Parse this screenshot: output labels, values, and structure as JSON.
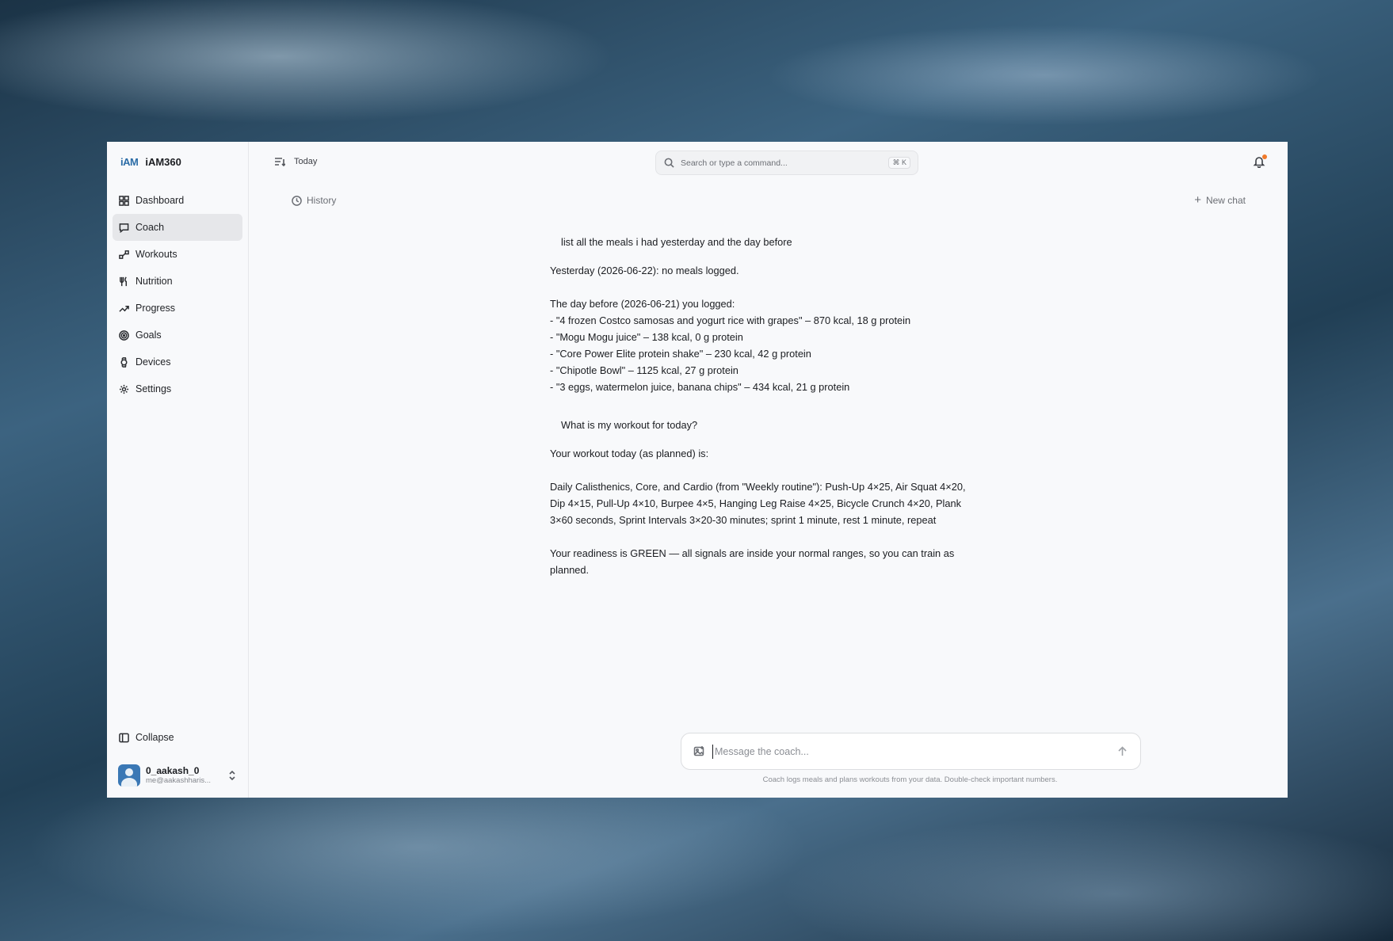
{
  "sidebar": {
    "brand_logo": "iAM",
    "brand_name": "iAM360",
    "items": [
      {
        "label": "Dashboard",
        "icon": "grid-icon"
      },
      {
        "label": "Coach",
        "icon": "chat-icon"
      },
      {
        "label": "Workouts",
        "icon": "dumbbell-icon"
      },
      {
        "label": "Nutrition",
        "icon": "utensils-icon"
      },
      {
        "label": "Progress",
        "icon": "trend-up-icon"
      },
      {
        "label": "Goals",
        "icon": "target-icon"
      },
      {
        "label": "Devices",
        "icon": "watch-icon"
      },
      {
        "label": "Settings",
        "icon": "gear-icon"
      }
    ],
    "active_index": 1,
    "collapse_label": "Collapse",
    "user": {
      "name": "0_aakash_0",
      "email": "me@aakashharis..."
    }
  },
  "topbar": {
    "title": "Today",
    "search_placeholder": "Search or type a command...",
    "search_shortcut": "⌘ K",
    "notification_dot_color": "#f07a2a"
  },
  "chat_header": {
    "history_label": "History",
    "new_chat_label": "New chat"
  },
  "messages": {
    "user_1": "list all the meals i had yesterday and the day before",
    "bot_1": {
      "line_1": "Yesterday (2026-06-22): no meals logged.",
      "line_2": "The day before (2026-06-21) you logged:",
      "items": [
        "- \"4 frozen Costco samosas and yogurt rice with grapes\" – 870 kcal, 18 g protein",
        "- \"Mogu Mogu juice\" – 138 kcal, 0 g protein",
        "- \"Core Power Elite protein shake\" – 230 kcal, 42 g protein",
        "- \"Chipotle Bowl\" – 1125 kcal, 27 g protein",
        "- \"3 eggs, watermelon juice, banana chips\" – 434 kcal, 21 g protein"
      ]
    },
    "user_2": "What is my workout for today?",
    "bot_2": {
      "intro": "Your workout today (as planned) is:",
      "plan_line_1": "Daily Calisthenics, Core, and Cardio (from \"Weekly routine\"): Push-Up 4×25, Air Squat 4×20,",
      "plan_line_2": "Dip 4×15, Pull-Up 4×10, Burpee 4×5, Hanging Leg Raise 4×25, Bicycle Crunch 4×20, Plank",
      "plan_line_3": "3×60 seconds, Sprint Intervals 3×20-30 minutes; sprint 1 minute, rest 1 minute, repeat",
      "readiness_line_1": "Your readiness is GREEN — all signals are inside your normal ranges, so you can train as",
      "readiness_line_2": "planned."
    }
  },
  "composer": {
    "placeholder": "Message the coach...",
    "value": "",
    "disclaimer": "Coach logs meals and plans workouts from your data. Double-check important numbers."
  }
}
